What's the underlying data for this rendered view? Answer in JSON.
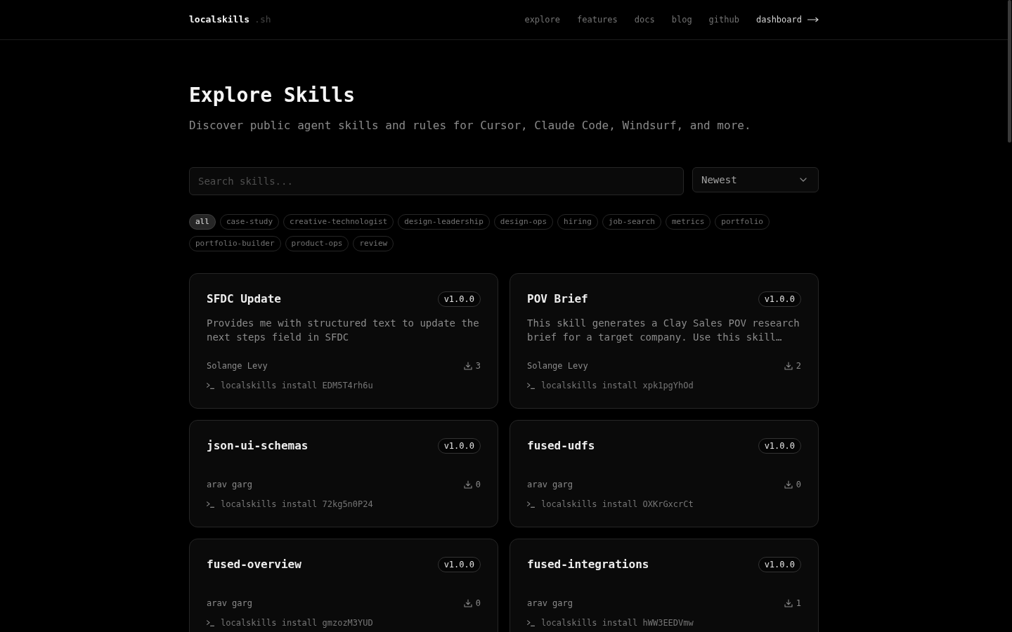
{
  "header": {
    "logo": "localskills",
    "logo_suffix": ".sh",
    "nav": [
      {
        "label": "explore",
        "kind": "link"
      },
      {
        "label": "features",
        "kind": "link"
      },
      {
        "label": "docs",
        "kind": "link"
      },
      {
        "label": "blog",
        "kind": "link"
      },
      {
        "label": "github",
        "kind": "link"
      },
      {
        "label": "dashboard",
        "kind": "cta"
      }
    ]
  },
  "hero": {
    "title": "Explore Skills",
    "subtitle": "Discover public agent skills and rules for Cursor, Claude Code, Windsurf, and more."
  },
  "search": {
    "placeholder": "Search skills..."
  },
  "sort": {
    "value": "Newest"
  },
  "tags": [
    {
      "label": "all",
      "selected": true
    },
    {
      "label": "case-study",
      "selected": false
    },
    {
      "label": "creative-technologist",
      "selected": false
    },
    {
      "label": "design-leadership",
      "selected": false
    },
    {
      "label": "design-ops",
      "selected": false
    },
    {
      "label": "hiring",
      "selected": false
    },
    {
      "label": "job-search",
      "selected": false
    },
    {
      "label": "metrics",
      "selected": false
    },
    {
      "label": "portfolio",
      "selected": false
    },
    {
      "label": "portfolio-builder",
      "selected": false
    },
    {
      "label": "product-ops",
      "selected": false
    },
    {
      "label": "review",
      "selected": false
    }
  ],
  "skills": [
    {
      "name": "SFDC Update",
      "version": "v1.0.0",
      "description": "Provides me with structured text to update the next steps field in SFDC",
      "author": "Solange Levy",
      "downloads": "3",
      "install_command": "localskills install EDM5T4rh6u"
    },
    {
      "name": "POV Brief",
      "version": "v1.0.0",
      "description": "This skill generates a Clay Sales POV research brief for a target company. Use this skill…",
      "author": "Solange Levy",
      "downloads": "2",
      "install_command": "localskills install xpk1pgYhOd"
    },
    {
      "name": "json-ui-schemas",
      "version": "v1.0.0",
      "author": "arav garg",
      "downloads": "0",
      "install_command": "localskills install 72kg5n0P24"
    },
    {
      "name": "fused-udfs",
      "version": "v1.0.0",
      "author": "arav garg",
      "downloads": "0",
      "install_command": "localskills install OXKrGxcrCt"
    },
    {
      "name": "fused-overview",
      "version": "v1.0.0",
      "author": "arav garg",
      "downloads": "0",
      "install_command": "localskills install gmzozM3YUD"
    },
    {
      "name": "fused-integrations",
      "version": "v1.0.0",
      "author": "arav garg",
      "downloads": "1",
      "install_command": "localskills install hWW3EEDVmw"
    }
  ]
}
